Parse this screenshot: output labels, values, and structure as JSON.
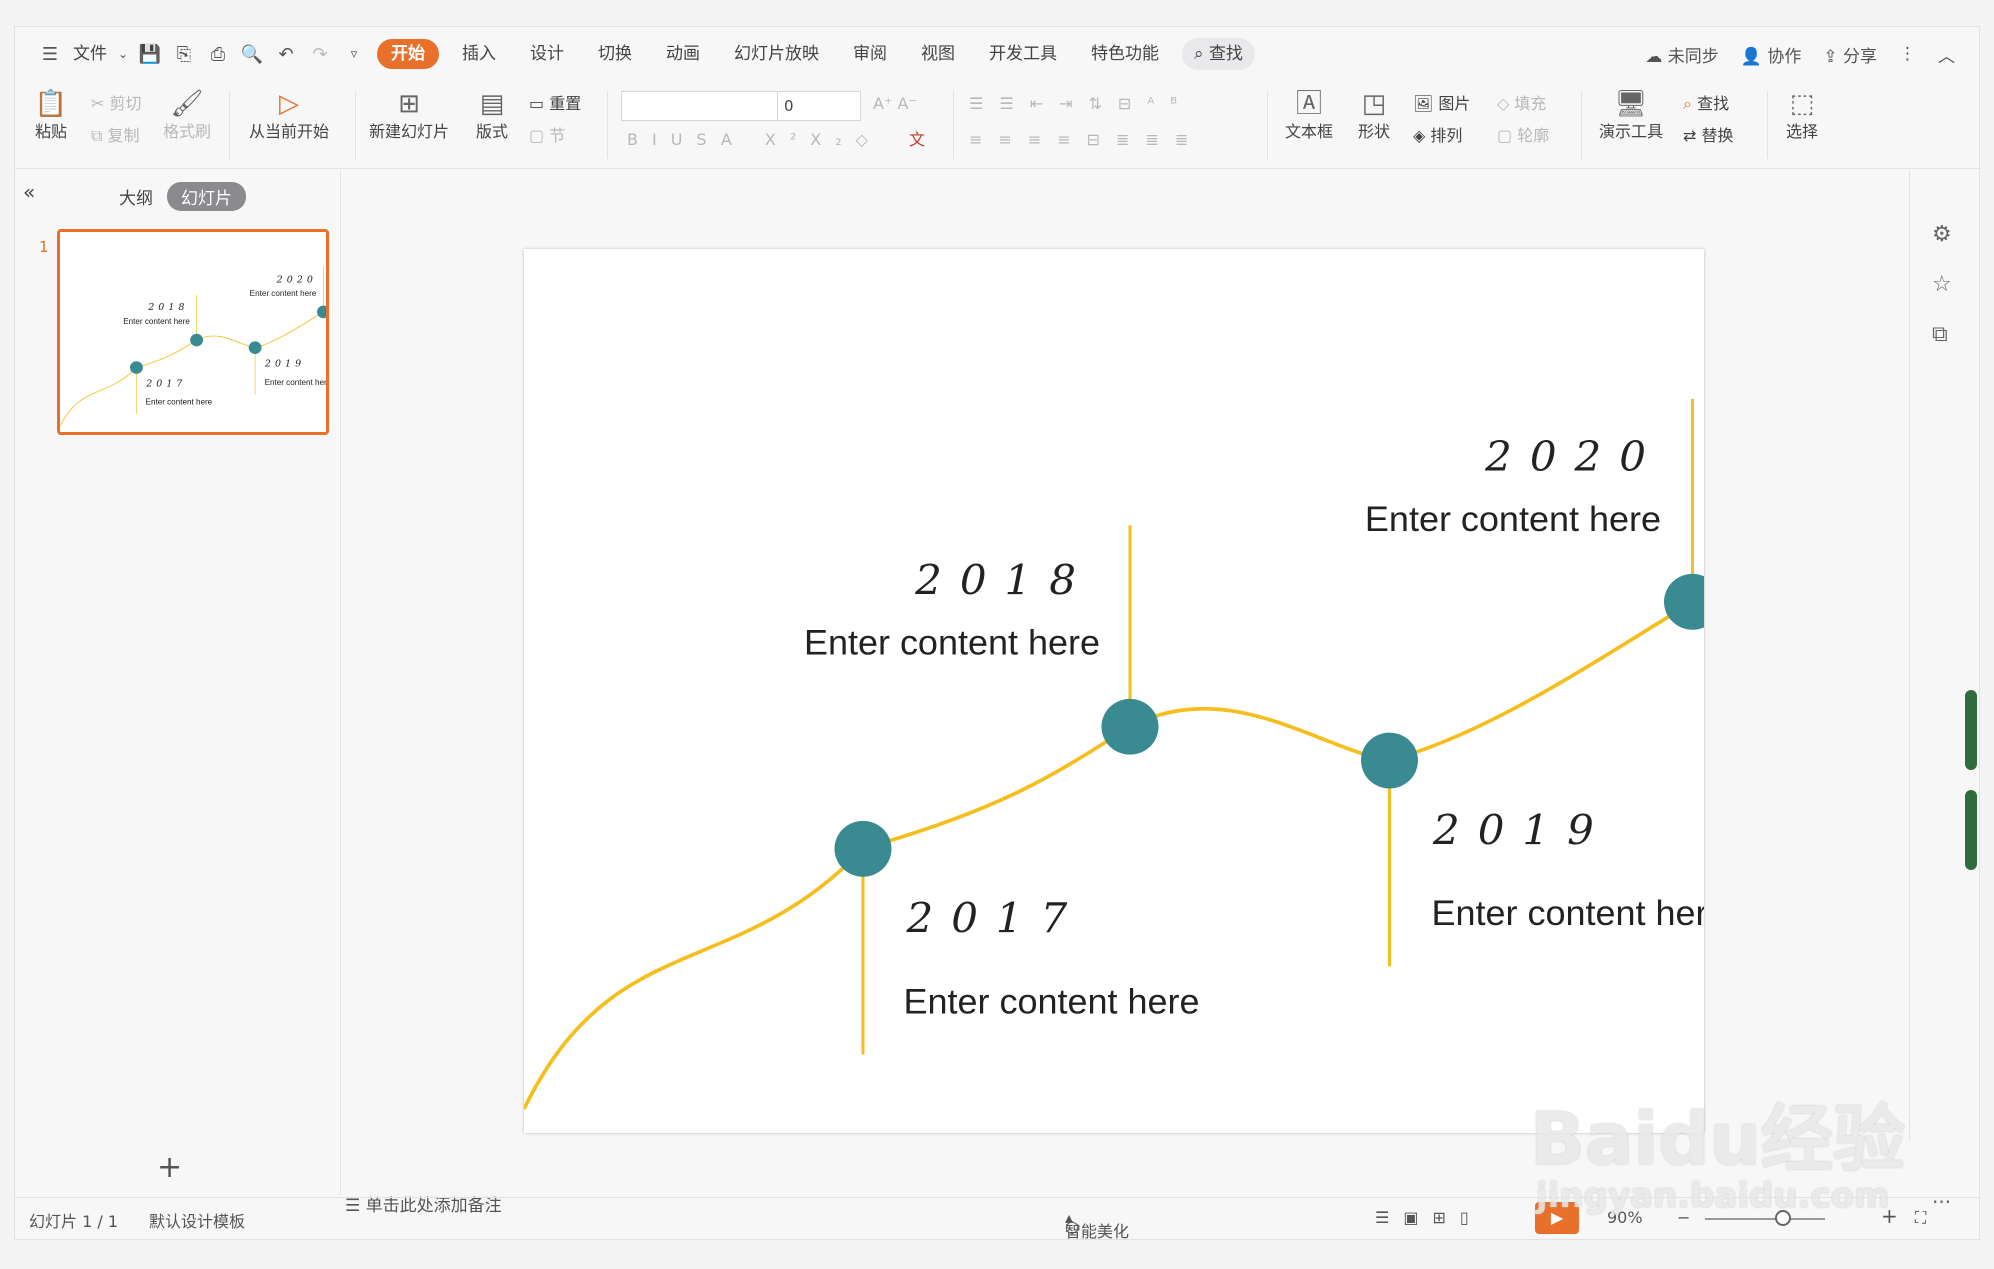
{
  "menu": {
    "file_label": "文件"
  },
  "tabs": [
    "开始",
    "插入",
    "设计",
    "切换",
    "动画",
    "幻灯片放映",
    "审阅",
    "视图",
    "开发工具",
    "特色功能"
  ],
  "search_label": "查找",
  "topright": {
    "sync": "未同步",
    "collab": "协作",
    "share": "分享"
  },
  "ribbon": {
    "paste": "粘贴",
    "cut": "剪切",
    "copy": "复制",
    "format_painter": "格式刷",
    "play_current": "从当前开始",
    "new_slide": "新建幻灯片",
    "layout": "版式",
    "reset": "重置",
    "section": "节",
    "font_size": "0",
    "textbox": "文本框",
    "shape": "形状",
    "picture": "图片",
    "fill": "填充",
    "arrange": "排列",
    "outline": "轮廓",
    "present_tools": "演示工具",
    "find": "查找",
    "replace": "替换",
    "select": "选择"
  },
  "leftpanel": {
    "outline_tab": "大纲",
    "slides_tab": "幻灯片",
    "slide_number": "1"
  },
  "slide": {
    "items": [
      {
        "year": "2017",
        "text": "Enter content here"
      },
      {
        "year": "2018",
        "text": "Enter content here"
      },
      {
        "year": "2019",
        "text": "Enter content here"
      },
      {
        "year": "2020",
        "text": "Enter content here"
      }
    ],
    "colors": {
      "curve": "#f6be1c",
      "dot": "#3a8a91"
    }
  },
  "notes_placeholder": "单击此处添加备注",
  "status": {
    "slide_count": "幻灯片 1 / 1",
    "template": "默认设计模板",
    "beautify": "智能美化",
    "zoom": "90%"
  },
  "watermark": {
    "brand": "Baidu经验",
    "url": "jingyan.baidu.com"
  }
}
